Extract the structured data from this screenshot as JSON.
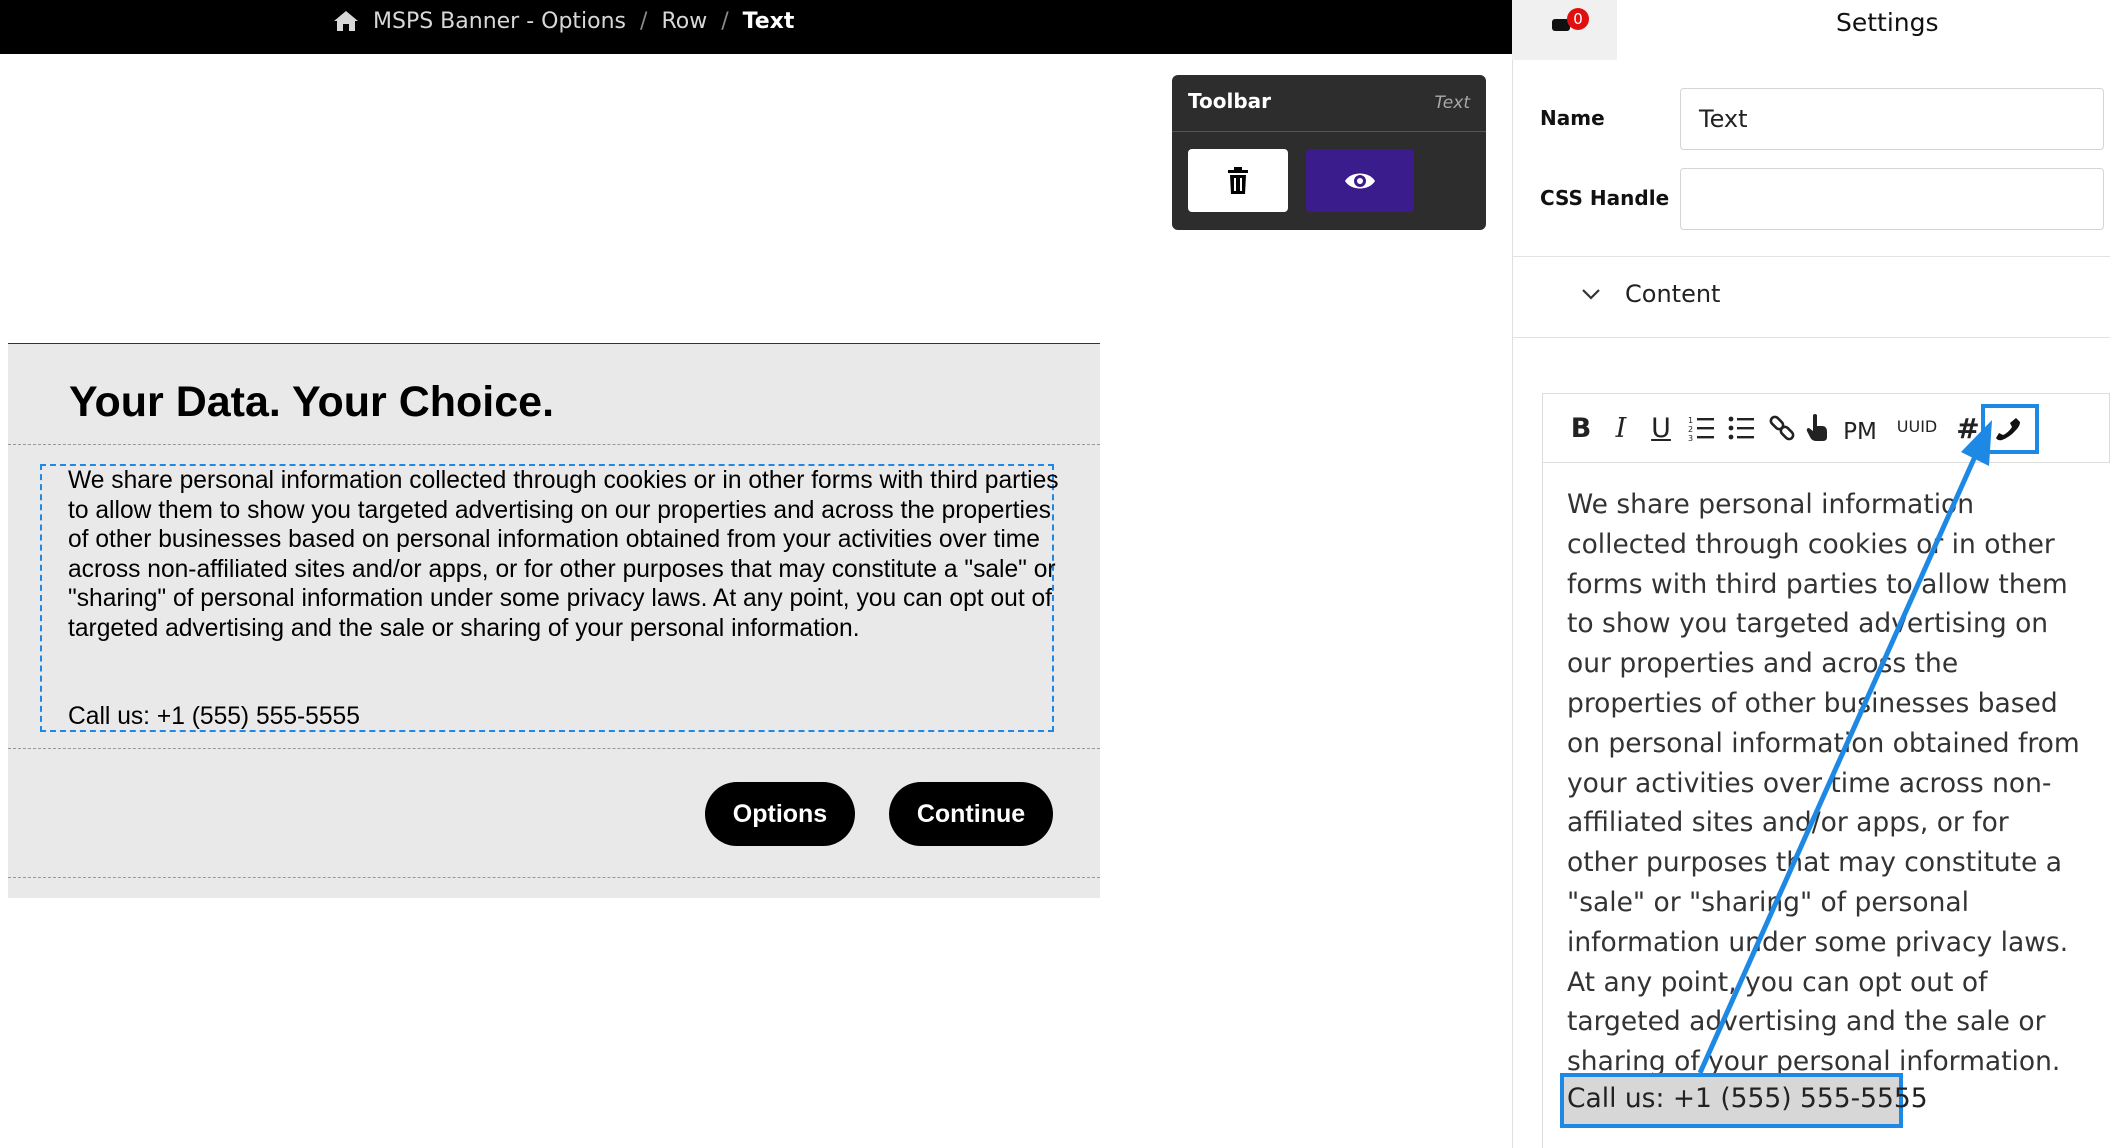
{
  "breadcrumb": {
    "home_icon": "home-icon",
    "items": [
      "MSPS Banner - Options",
      "Row"
    ],
    "current": "Text",
    "separator": "/"
  },
  "toolbar": {
    "title": "Toolbar",
    "tag": "Text",
    "delete_icon": "trash-icon",
    "preview_icon": "eye-icon",
    "preview_color": "#3b1c8c"
  },
  "banner": {
    "title": "Your Data. Your Choice.",
    "body": "We share personal information collected through cookies or in other forms with third parties to allow them to show you targeted advertising on our properties and across the properties of other businesses based on personal information obtained from your activities over time across non-affiliated sites and/or apps, or for other purposes that may constitute a \"sale\" or \"sharing\" of personal information under some privacy laws. At any point, you can opt out of targeted advertising and the sale or sharing of your personal information.",
    "call": "Call us: +1 (555) 555-5555",
    "options_label": "Options",
    "continue_label": "Continue"
  },
  "panel": {
    "notification_count": "0",
    "title": "Settings",
    "name_label": "Name",
    "name_value": "Text",
    "css_label": "CSS Handle",
    "css_value": "",
    "section_label": "Content",
    "editor_tools": [
      "B",
      "I",
      "U",
      "ordered-list-icon",
      "bullet-list-icon",
      "link-icon",
      "pointer-icon",
      "PM",
      "UUID",
      "#",
      "phone-icon"
    ],
    "editor_text": "We share personal information collected through cookies or in other forms with third parties to allow them to show you targeted advertising on our properties and across the properties of other businesses based on personal information obtained from your activities over time across non-affiliated sites and/or apps, or for other purposes that may constitute a \"sale\" or \"sharing\" of personal information under some privacy laws. At any point, you can opt out of targeted advertising and the sale or sharing of your personal information.",
    "editor_call": "Call us: +1 (555) 555-5555"
  },
  "colors": {
    "accent_blue": "#1e88e5",
    "badge_red": "#e01010"
  }
}
